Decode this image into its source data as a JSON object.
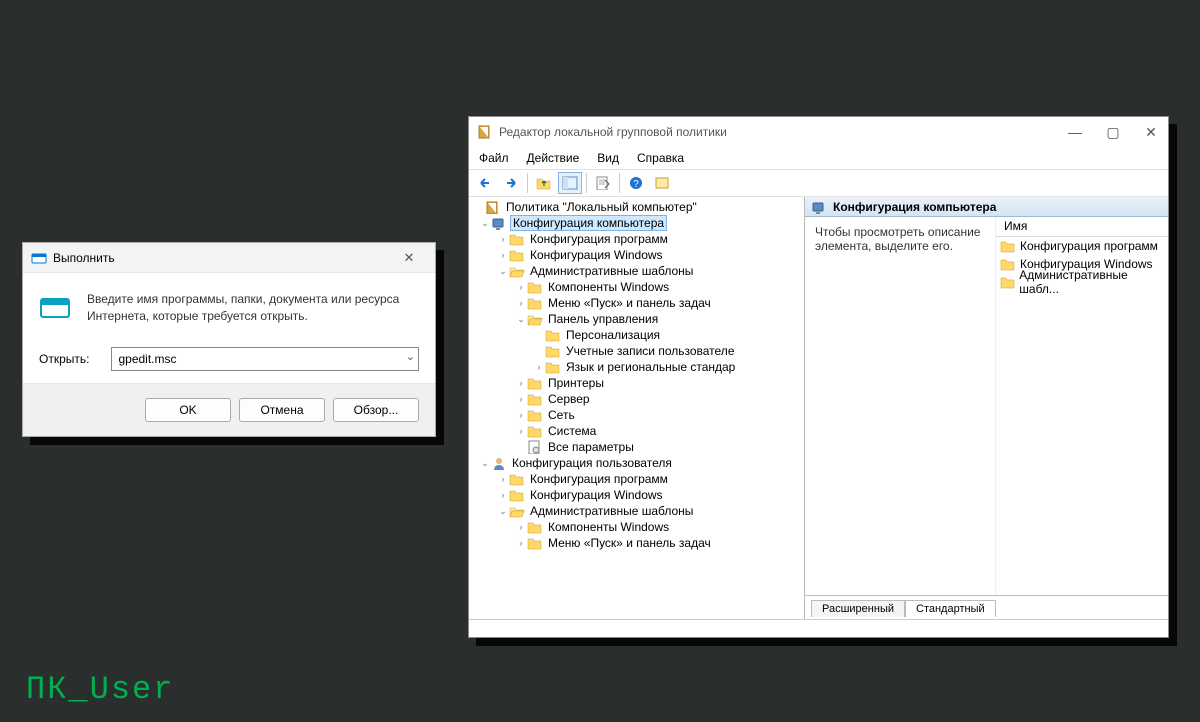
{
  "watermark": "ПК_User",
  "run": {
    "title": "Выполнить",
    "desc": "Введите имя программы, папки, документа или ресурса Интернета, которые требуется открыть.",
    "open_label": "Открыть:",
    "value": "gpedit.msc",
    "ok": "OK",
    "cancel": "Отмена",
    "browse": "Обзор..."
  },
  "gpe": {
    "title": "Редактор локальной групповой политики",
    "menu": {
      "file": "Файл",
      "action": "Действие",
      "view": "Вид",
      "help": "Справка"
    },
    "tree": {
      "root": "Политика \"Локальный компьютер\"",
      "comp": "Конфигурация компьютера",
      "comp_soft": "Конфигурация программ",
      "comp_win": "Конфигурация Windows",
      "comp_admin": "Административные шаблоны",
      "win_comp": "Компоненты Windows",
      "start_task": "Меню «Пуск» и панель задач",
      "ctrl_panel": "Панель управления",
      "personal": "Персонализация",
      "user_acc": "Учетные записи пользователе",
      "lang_reg": "Язык и региональные стандар",
      "printers": "Принтеры",
      "server": "Сервер",
      "network": "Сеть",
      "system": "Система",
      "all_params": "Все параметры",
      "user": "Конфигурация пользователя",
      "user_soft": "Конфигурация программ",
      "user_win": "Конфигурация Windows",
      "user_admin": "Административные шаблоны",
      "user_wincomp": "Компоненты Windows",
      "user_start": "Меню «Пуск» и панель задач"
    },
    "right": {
      "header": "Конфигурация компьютера",
      "desc": "Чтобы просмотреть описание элемента, выделите его.",
      "col_name": "Имя",
      "items": {
        "i0": "Конфигурация программ",
        "i1": "Конфигурация Windows",
        "i2": "Административные шабл..."
      }
    },
    "tabs": {
      "ext": "Расширенный",
      "std": "Стандартный"
    }
  }
}
